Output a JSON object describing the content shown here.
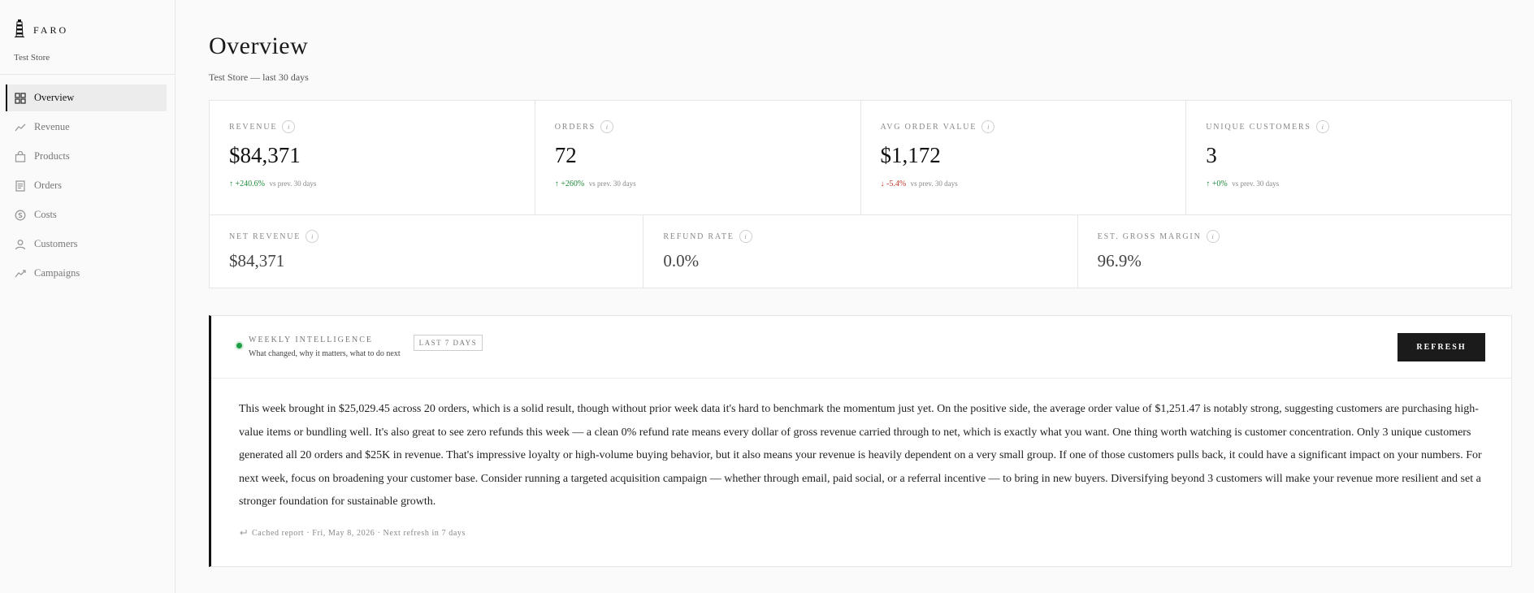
{
  "brand": {
    "name": "FARO",
    "store": "Test Store",
    "logo_icon": "lighthouse-icon"
  },
  "nav": {
    "items": [
      {
        "label": "Overview",
        "icon": "grid-icon",
        "active": true
      },
      {
        "label": "Revenue",
        "icon": "trend-icon",
        "active": false
      },
      {
        "label": "Products",
        "icon": "bag-icon",
        "active": false
      },
      {
        "label": "Orders",
        "icon": "receipt-icon",
        "active": false
      },
      {
        "label": "Costs",
        "icon": "coin-icon",
        "active": false
      },
      {
        "label": "Customers",
        "icon": "user-icon",
        "active": false
      },
      {
        "label": "Campaigns",
        "icon": "trend-icon",
        "active": false
      }
    ]
  },
  "header": {
    "title": "Overview",
    "subtitle": "Test Store — last 30 days"
  },
  "metrics": {
    "top": [
      {
        "label": "REVENUE",
        "value": "$84,371",
        "delta": "↑ +240.6%",
        "direction": "up",
        "note": "vs prev. 30 days"
      },
      {
        "label": "ORDERS",
        "value": "72",
        "delta": "↑ +260%",
        "direction": "up",
        "note": "vs prev. 30 days"
      },
      {
        "label": "AVG ORDER VALUE",
        "value": "$1,172",
        "delta": "↓ -5.4%",
        "direction": "down",
        "note": "vs prev. 30 days"
      },
      {
        "label": "UNIQUE CUSTOMERS",
        "value": "3",
        "delta": "↑ +0%",
        "direction": "up",
        "note": "vs prev. 30 days"
      }
    ],
    "bottom": [
      {
        "label": "NET REVENUE",
        "value": "$84,371"
      },
      {
        "label": "REFUND RATE",
        "value": "0.0%"
      },
      {
        "label": "EST. GROSS MARGIN",
        "value": "96.9%"
      }
    ],
    "info_glyph": "i"
  },
  "weekly": {
    "title": "WEEKLY INTELLIGENCE",
    "subtitle": "What changed, why it matters, what to do next",
    "badge": "LAST 7 DAYS",
    "refresh_label": "REFRESH",
    "body": "This week brought in $25,029.45 across 20 orders, which is a solid result, though without prior week data it's hard to benchmark the momentum just yet. On the positive side, the average order value of $1,251.47 is notably strong, suggesting customers are purchasing high-value items or bundling well. It's also great to see zero refunds this week — a clean 0% refund rate means every dollar of gross revenue carried through to net, which is exactly what you want. One thing worth watching is customer concentration. Only 3 unique customers generated all 20 orders and $25K in revenue. That's impressive loyalty or high-volume buying behavior, but it also means your revenue is heavily dependent on a very small group. If one of those customers pulls back, it could have a significant impact on your numbers. For next week, focus on broadening your customer base. Consider running a targeted acquisition campaign — whether through email, paid social, or a referral incentive — to bring in new buyers. Diversifying beyond 3 customers will make your revenue more resilient and set a stronger foundation for sustainable growth.",
    "footer": "Cached report · Fri, May 8, 2026 · Next refresh in 7 days",
    "footer_icon": "return-arrow-icon"
  },
  "colors": {
    "up": "#1e8a3a",
    "down": "#c0392b",
    "status": "#1e9e45",
    "accent": "#111111"
  }
}
